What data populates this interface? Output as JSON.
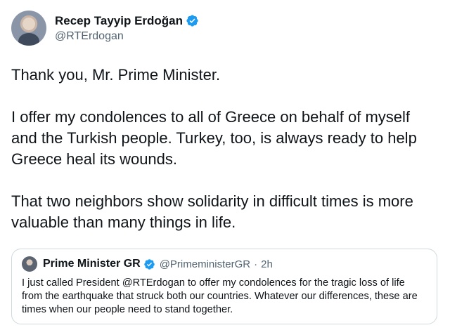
{
  "author": {
    "display_name": "Recep Tayyip Erdoğan",
    "handle": "@RTErdogan",
    "verified_icon": "verified-badge-icon"
  },
  "tweet": {
    "paragraphs": [
      "Thank you, Mr. Prime Minister.",
      "I offer my condolences to all of Greece on behalf of myself and the Turkish people. Turkey, too, is always ready to help Greece heal its wounds.",
      "That two neighbors show solidarity in difficult times is more valuable than many things in life."
    ]
  },
  "quoted_tweet": {
    "display_name": "Prime Minister GR",
    "handle": "@PrimeministerGR",
    "separator": "·",
    "time": "2h",
    "text": "I just called President @RTErdogan to offer my condolences for the tragic loss of life from the earthquake that struck both our countries. Whatever our differences, these are times when our people need to stand together."
  },
  "colors": {
    "verified_blue": "#1d9bf0",
    "secondary_text": "#536471",
    "border": "#cfd9de"
  }
}
